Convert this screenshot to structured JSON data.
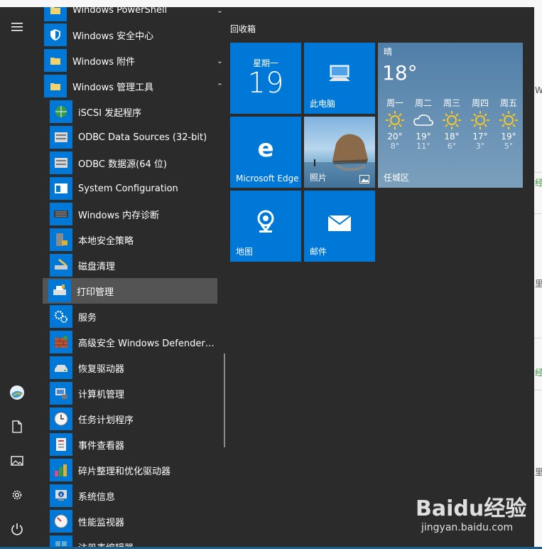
{
  "background_app": {
    "fragments": [
      "Wi",
      "经验",
      "里轴",
      "经验",
      "里轴"
    ]
  },
  "rail": {
    "menu_icon": "hamburger-icon",
    "items": [
      {
        "name": "user-avatar",
        "icon": "avatar-icon"
      },
      {
        "name": "documents",
        "icon": "document-icon"
      },
      {
        "name": "pictures",
        "icon": "picture-icon"
      },
      {
        "name": "settings",
        "icon": "gear-icon"
      },
      {
        "name": "power",
        "icon": "power-icon"
      }
    ]
  },
  "app_list": {
    "folders": [
      {
        "label": "Windows PowerShell",
        "expanded": false
      },
      {
        "label": "Windows 安全中心"
      },
      {
        "label": "Windows 附件",
        "expanded": false
      },
      {
        "label": "Windows 管理工具",
        "expanded": true
      }
    ],
    "items": [
      {
        "label": "iSCSI 发起程序"
      },
      {
        "label": "ODBC Data Sources (32-bit)"
      },
      {
        "label": "ODBC 数据源(64 位)"
      },
      {
        "label": "System Configuration"
      },
      {
        "label": "Windows 内存诊断"
      },
      {
        "label": "本地安全策略"
      },
      {
        "label": "磁盘清理"
      },
      {
        "label": "打印管理",
        "selected": true
      },
      {
        "label": "服务"
      },
      {
        "label": "高级安全 Windows Defender 防..."
      },
      {
        "label": "恢复驱动器"
      },
      {
        "label": "计算机管理"
      },
      {
        "label": "任务计划程序"
      },
      {
        "label": "事件查看器"
      },
      {
        "label": "碎片整理和优化驱动器"
      },
      {
        "label": "系统信息"
      },
      {
        "label": "性能监视器"
      },
      {
        "label": "注册表编辑器"
      }
    ]
  },
  "tiles": {
    "group_title": "回收箱",
    "calendar": {
      "day": "星期一",
      "date": "19"
    },
    "this_pc": {
      "label": "此电脑"
    },
    "edge": {
      "label": "Microsoft Edge"
    },
    "photos": {
      "label": "照片"
    },
    "maps": {
      "label": "地图"
    },
    "mail": {
      "label": "邮件"
    },
    "weather": {
      "condition": "晴",
      "temp": "18°",
      "location": "任城区",
      "forecast": [
        {
          "day": "周一",
          "icon": "sun-icon",
          "hi": "20°",
          "lo": "8°"
        },
        {
          "day": "周二",
          "icon": "cloud-icon",
          "hi": "19°",
          "lo": "11°"
        },
        {
          "day": "周三",
          "icon": "sun-icon",
          "hi": "18°",
          "lo": "6°"
        },
        {
          "day": "周四",
          "icon": "sun-icon",
          "hi": "17°",
          "lo": "3°"
        },
        {
          "day": "周五",
          "icon": "sun-icon",
          "hi": "19°",
          "lo": "5°"
        }
      ]
    }
  },
  "watermark": {
    "brand": "Baidu经验",
    "url": "jingyan.baidu.com"
  },
  "colors": {
    "accent": "#0078d7",
    "menu_bg": "#2b2b2b",
    "selected_row": "#545454"
  }
}
